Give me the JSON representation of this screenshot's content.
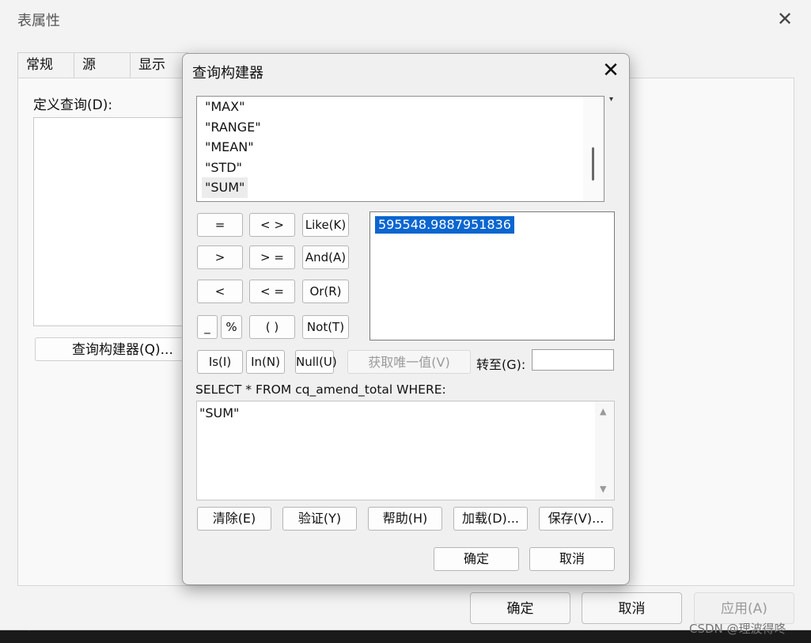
{
  "outer_window": {
    "title": "表属性",
    "close_glyph": "✕",
    "tabs": [
      "常规",
      "源",
      "显示"
    ],
    "definition_query_label": "定义查询(D):",
    "query_builder_button": "查询构建器(Q)...",
    "buttons": {
      "ok": "确定",
      "cancel": "取消",
      "apply": "应用(A)"
    }
  },
  "dialog": {
    "title": "查询构建器",
    "close_glyph": "✕",
    "field_list": {
      "items": [
        "\"MAX\"",
        "\"RANGE\"",
        "\"MEAN\"",
        "\"STD\"",
        "\"SUM\""
      ],
      "selected_index": 4
    },
    "operators": {
      "eq": "=",
      "ne": "< >",
      "like": "Like(K)",
      "gt": ">",
      "ge": "> =",
      "and": "And(A)",
      "lt": "<",
      "le": "< =",
      "or": "Or(R)",
      "underscore": "_",
      "percent": "%",
      "parens": "( )",
      "not": "Not(T)",
      "is": "Is(I)",
      "in": "In(N)",
      "null": "Null(U)"
    },
    "unique_values": [
      "595548.9887951836"
    ],
    "get_unique_button": "获取唯一值(V)",
    "goto_label": "转至(G):",
    "goto_value": "",
    "where_label": "SELECT * FROM cq_amend_total WHERE:",
    "expression": "\"SUM\"",
    "actions": {
      "clear": "清除(E)",
      "verify": "验证(Y)",
      "help": "帮助(H)",
      "load": "加载(D)...",
      "save": "保存(V)..."
    },
    "ok": "确定",
    "cancel": "取消"
  },
  "watermark": "CSDN @理波得咚"
}
